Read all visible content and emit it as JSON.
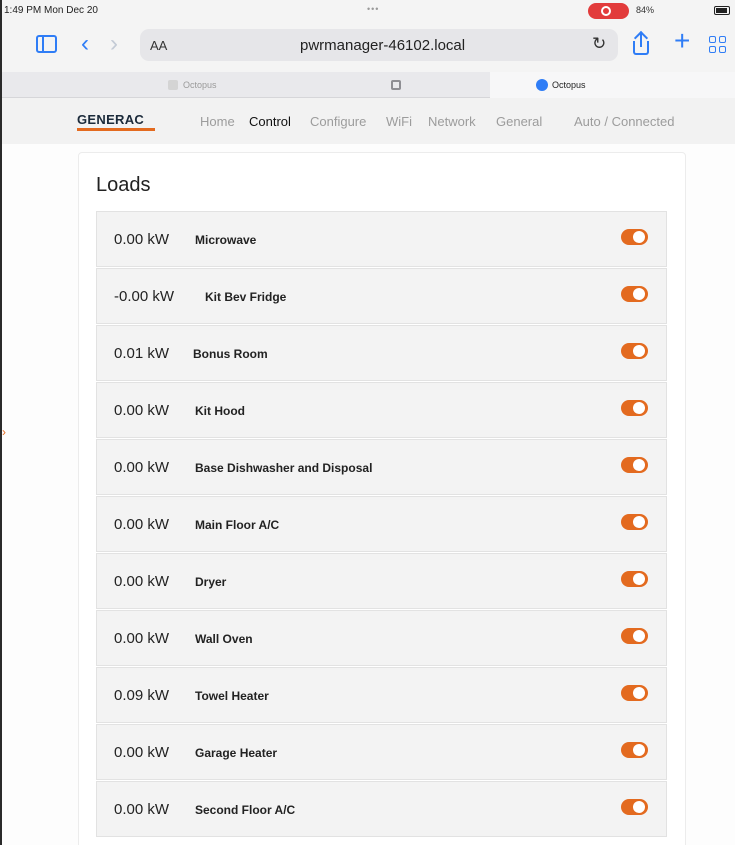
{
  "status_bar": {
    "time": "1:49 PM  Mon Dec 20",
    "dots": "•••",
    "right": "84%"
  },
  "browser": {
    "aa": "AA",
    "url": "pwrmanager-46102.local",
    "tabs": [
      {
        "label": "Octopus"
      },
      {
        "label": ""
      },
      {
        "label": "Octopus"
      }
    ]
  },
  "nav": {
    "logo": "GENERAC",
    "links": [
      "Home",
      "Control",
      "Configure",
      "WiFi",
      "Network",
      "General",
      "Auto / Connected"
    ],
    "active": "Control"
  },
  "page": {
    "title": "Loads"
  },
  "colors": {
    "accent": "#e36a1f",
    "browser_blue": "#2f7df6"
  },
  "loads": [
    {
      "kw": "0.00 kW",
      "name": "Microwave",
      "enabled": true
    },
    {
      "kw": "-0.00 kW",
      "name": "Kit Bev Fridge",
      "enabled": true
    },
    {
      "kw": "0.01 kW",
      "name": "Bonus Room",
      "enabled": true
    },
    {
      "kw": "0.00 kW",
      "name": "Kit Hood",
      "enabled": true
    },
    {
      "kw": "0.00 kW",
      "name": "Base Dishwasher and Disposal",
      "enabled": true
    },
    {
      "kw": "0.00 kW",
      "name": "Main Floor A/C",
      "enabled": true
    },
    {
      "kw": "0.00 kW",
      "name": "Dryer",
      "enabled": true
    },
    {
      "kw": "0.00 kW",
      "name": "Wall Oven",
      "enabled": true
    },
    {
      "kw": "0.09 kW",
      "name": "Towel Heater",
      "enabled": true
    },
    {
      "kw": "0.00 kW",
      "name": "Garage Heater",
      "enabled": true
    },
    {
      "kw": "0.00 kW",
      "name": "Second Floor A/C",
      "enabled": true
    }
  ]
}
